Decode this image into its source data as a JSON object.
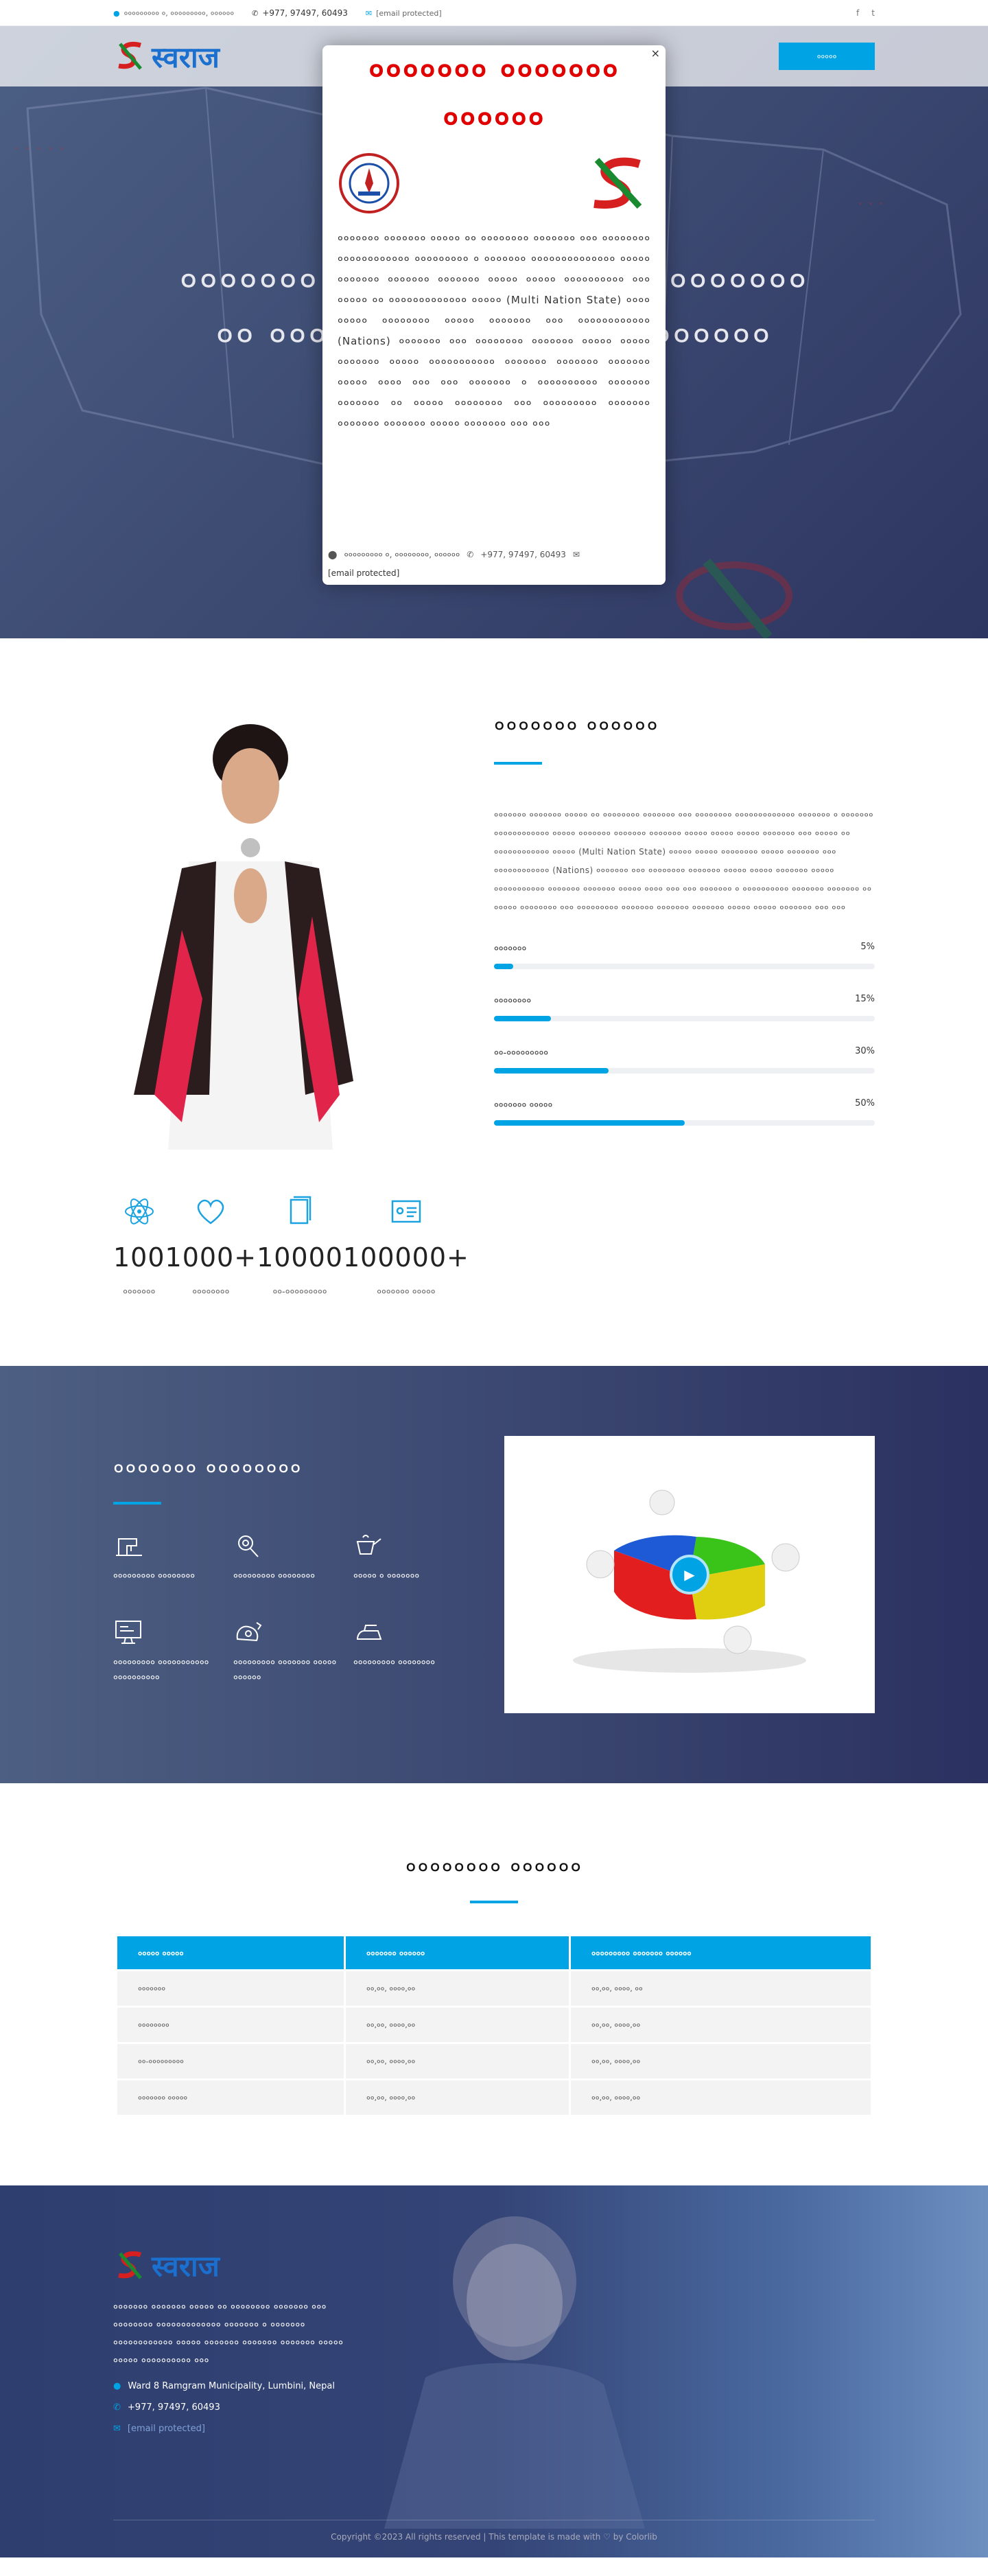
{
  "topbar": {
    "address": "००००००००० ०, ०००००००००, ००००००",
    "phone": "+977, 97497, 60493",
    "email": "[email protected]",
    "social": [
      "f",
      "t"
    ]
  },
  "nav": {
    "logo_text": "स्वराज",
    "button_label": "०००००"
  },
  "hero": {
    "title_line1": "००००००० ००० ०००००००० ००० ००००००००",
    "title_line2": "०० ००००००००० ००००००० ००००००००"
  },
  "modal": {
    "close": "×",
    "title_line1": "००००००० ००००००० ",
    "title_line2": "००००००",
    "body": "००००००० ००००००० ००००० ०० ०००००००० ००००००० ००० ०००००००० ०००००००००००० ००००००००० ० ००००००० ०००००००००००००० ००००० ००००००० ००००००० ००००००० ००००० ००००० ०००००००००० ००० ००००० ०० ००००००००००००० ००००० (Multi Nation State) ०००० ००००० ०००००००० ००००० ००००००० ००० ०००००००००००० (Nations) ००००००० ००० ०००००००० ००००००० ००००० ००००० ००००००० ००००० ००००००००००० ००००००० ००००००० ००००००० ००००० ०००० ००० ००० ००००००० ० ०००००००००० ००००००० ००००००० ०० ००००० ०००००००० ००० ००००००००० ००००००० ००००००० ००००००० ००००० ००००००० ००० ०००",
    "address": "००००००००० ०, ००००००००, ००००००",
    "phone": "+977, 97497, 60493",
    "email": "[email protected]"
  },
  "about": {
    "title": "००००००० ००००००",
    "description": "००००००० ००००००० ००००० ०० ०००००००० ००००००० ००० ०००००००० ००००००००००००० ००००००० ० ००००००० ०००००००००००० ००००० ००००००० ००००००० ००००००० ००००० ००००० ००००० ००००००० ००० ००००० ०० ०००००००००००० ००००० (Multi Nation State) ००००० ००००० ०००००००० ००००० ००००००० ००० ०००००००००००० (Nations) ००००००० ००० ०००००००० ००००००० ००००० ००००० ००००००० ००००० ००००००००००० ००००००० ००००००० ००००० ०००० ००० ००० ००००००० ० ०००००००००० ००००००० ००००००० ०० ००००० ०००००००० ००० ००००००००० ००००००० ००००००० ००००००० ००००० ००००० ००००००० ००० ०००",
    "skills": [
      {
        "label": "०००००००",
        "value": "5%",
        "fraction": 0.05
      },
      {
        "label": "००००००००",
        "value": "15%",
        "fraction": 0.15
      },
      {
        "label": "००-०००००००००",
        "value": "30%",
        "fraction": 0.3
      },
      {
        "label": "००००००० ०००००",
        "value": "50%",
        "fraction": 0.5
      }
    ]
  },
  "counters": [
    {
      "icon": "atom-icon",
      "number": "100",
      "label": "०००००००"
    },
    {
      "icon": "heart-icon",
      "number": "1000+",
      "label": "००००००००"
    },
    {
      "icon": "book-icon",
      "number": "10000",
      "label": "००-०००००००००"
    },
    {
      "icon": "id-card-icon",
      "number": "100000+",
      "label": "००००००० ०००००"
    }
  ],
  "services": {
    "title": "००००००० ००००००००",
    "items": [
      {
        "icon": "sewing-machine-icon",
        "label": "००००००००० ००००००००"
      },
      {
        "icon": "magnifier-icon",
        "label": "००००००००० ००००००००"
      },
      {
        "icon": "pot-icon",
        "label": "००००० ० ०००००००"
      },
      {
        "icon": "monitor-icon",
        "label": "००००००००० ००००००००००० ००००००००००"
      },
      {
        "icon": "hands-icon",
        "label": "००००००००० ००००००० ००००० ००००००"
      },
      {
        "icon": "iron-icon",
        "label": "००००००००० ००००००००"
      }
    ]
  },
  "table": {
    "title": "०००००००० ००००००",
    "headers": [
      "००००० ०००००",
      "००००००० ००००००",
      "००००००००० ००००००० ००००००"
    ],
    "rows": [
      [
        "०००००००",
        "००,००, ००००,००",
        "००,००, ००००, ००"
      ],
      [
        "००००००००",
        "००,००, ००००,००",
        "००,००, ००००,००"
      ],
      [
        "००-०००००००००",
        "००,००, ००००,००",
        "००,००, ००००,००"
      ],
      [
        "००००००० ०००००",
        "००,००, ००००,००",
        "००,००, ००००,००"
      ]
    ]
  },
  "footer": {
    "logo_text": "स्वराज",
    "blurb": "००००००० ००००००० ००००० ०० ०००००००० ००००००० ००० ०००००००० ००००००००००००० ००००००० ० ००००००० ०००००००००००० ००००० ००००००० ००००००० ००००००० ००००० ००००० ०००००००००० ००० ",
    "address": "Ward 8 Ramgram Municipality, Lumbini, Nepal",
    "phone": "+977, 97497, 60493",
    "email": "[email protected]",
    "copyright": "Copyright ©2023 All rights reserved | This template is made with ♡ by Colorlib"
  }
}
